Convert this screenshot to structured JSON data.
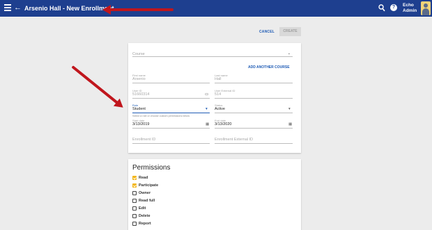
{
  "header": {
    "back": "←",
    "title": "Arsenio Hall - New Enrollment",
    "help": "?",
    "user_line1": "Echo",
    "user_line2": "Admin",
    "color": "#1e3f8f"
  },
  "actions": {
    "cancel": "CANCEL",
    "create": "CREATE"
  },
  "form": {
    "course_placeholder": "Course",
    "add_course": "ADD ANOTHER COURSE",
    "first_name_label": "First name",
    "first_name_value": "Arsenio",
    "last_name_label": "Last name",
    "last_name_value": "Hall",
    "user_id_label": "User ID",
    "user_id_value": "51660314",
    "user_ext_id_label": "User External ID",
    "user_ext_id_value": "514",
    "role_label": "Role",
    "role_value": "Student",
    "status_label": "Status",
    "status_value": "Active",
    "role_hint": "Select a role or choose custom permissions below",
    "start_date_label": "Start date",
    "start_date_value": "3/13/2019",
    "end_date_label": "End date",
    "end_date_value": "3/13/2020",
    "enrollment_id_placeholder": "Enrollment ID",
    "enrollment_ext_id_placeholder": "Enrollment External ID"
  },
  "permissions": {
    "title": "Permissions",
    "items": [
      {
        "label": "Read",
        "checked": true
      },
      {
        "label": "Participate",
        "checked": true
      },
      {
        "label": "Owner",
        "checked": false
      },
      {
        "label": "Read full",
        "checked": false
      },
      {
        "label": "Edit",
        "checked": false
      },
      {
        "label": "Delete",
        "checked": false
      },
      {
        "label": "Report",
        "checked": false
      }
    ]
  },
  "colors": {
    "accent": "#1e5bb5",
    "checkbox_on": "#f2b619",
    "annotation_arrow": "#c0161d"
  }
}
